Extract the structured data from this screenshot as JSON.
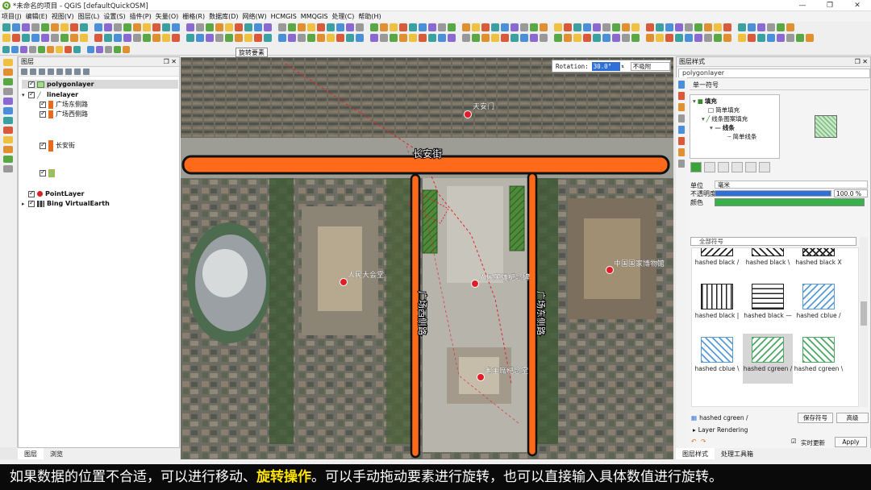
{
  "window": {
    "title": "*未命名的项目 - QGIS [defaultQuickOSM]",
    "buttons": [
      "—",
      "❐",
      "✕"
    ]
  },
  "menu": [
    "项目(J)",
    "编辑(E)",
    "视图(V)",
    "图层(L)",
    "设置(S)",
    "插件(P)",
    "矢量(O)",
    "栅格(R)",
    "数据库(D)",
    "网络(W)",
    "HCMGIS",
    "MMQGIS",
    "处理(C)",
    "帮助(H)"
  ],
  "tooltip": "旋转要素",
  "layers_panel": {
    "title": "图层",
    "tabs": [
      "图层",
      "浏览"
    ],
    "items": [
      {
        "label": "polygonlayer",
        "checked": true,
        "bold": true,
        "selected": true
      },
      {
        "label": "linelayer",
        "checked": true,
        "bold": true
      },
      {
        "label": "广场东侧路",
        "checked": true,
        "swatch": "#e86a1c"
      },
      {
        "label": "广场西侧路",
        "checked": true,
        "swatch": "#e86a1c"
      },
      {
        "label": "长安街",
        "checked": true,
        "swatch": "#e86a1c"
      },
      {
        "label": "",
        "checked": true,
        "swatch": "#8ec46a"
      },
      {
        "label": "PointLayer",
        "checked": true,
        "bold": true
      },
      {
        "label": "Bing VirtualEarth",
        "checked": true,
        "bold": true
      }
    ]
  },
  "map": {
    "rotation_label": "Rotation:",
    "rotation_value": "30.0°",
    "snapping_option": "不吸附",
    "labels": {
      "tiananmen": "天安门",
      "changanjie": "长安街",
      "great_hall": "人民大会堂",
      "monument": "人民英雄纪念碑",
      "museum": "中国国家博物馆",
      "mausoleum": "毛主席纪念堂",
      "west_road": "广场西侧路",
      "east_road": "广场东侧路"
    },
    "colors": {
      "road": "#ff6a1a",
      "road_outline": "#111111",
      "point": "#e01e2b",
      "polygon": "#7ec96e"
    }
  },
  "style_panel": {
    "title": "图层样式",
    "layer": "polygonlayer",
    "renderer": "单一符号",
    "tree": [
      {
        "label": "填充",
        "bold": true
      },
      {
        "label": "简单填充"
      },
      {
        "label": "线条图案填充"
      },
      {
        "label": "线条",
        "bold": true
      },
      {
        "label": "简单线条"
      }
    ],
    "unit_label": "单位",
    "unit_value": "毫米",
    "opacity_label": "不透明度",
    "opacity_value": "100.0 %",
    "opacity_fraction": 1.0,
    "color_label": "颜色",
    "color_value": "#37b14a",
    "search_placeholder": "全部符号",
    "gallery": [
      {
        "label": "hashed black /",
        "pattern": "fwd",
        "color": "#222222"
      },
      {
        "label": "hashed black \\",
        "pattern": "back",
        "color": "#222222"
      },
      {
        "label": "hashed black X",
        "pattern": "cross",
        "color": "#222222"
      },
      {
        "label": "hashed black |",
        "pattern": "vert",
        "color": "#222222"
      },
      {
        "label": "hashed black —",
        "pattern": "horiz",
        "color": "#222222"
      },
      {
        "label": "hashed cblue /",
        "pattern": "fwd",
        "color": "#5a9ad6"
      },
      {
        "label": "hashed cblue \\",
        "pattern": "back",
        "color": "#5a9ad6"
      },
      {
        "label": "hashed cgreen /",
        "pattern": "fwd",
        "color": "#4fa865",
        "selected": true
      },
      {
        "label": "hashed cgreen \\",
        "pattern": "back",
        "color": "#4fa865"
      }
    ],
    "current_symbol": "hashed cgreen /",
    "save_symbol": "保存符号",
    "advanced": "高级",
    "layer_rendering": "Layer Rendering",
    "live_update": "实时更新",
    "apply": "Apply",
    "tabs": [
      "图层样式",
      "处理工具箱"
    ]
  },
  "subtitle": {
    "part1": "如果数据的位置不合适，可以进行移动、",
    "highlight": "旋转操作",
    "part2": "。可以手动拖动要素进行旋转，也可以直接输入具体数值进行旋转。"
  }
}
